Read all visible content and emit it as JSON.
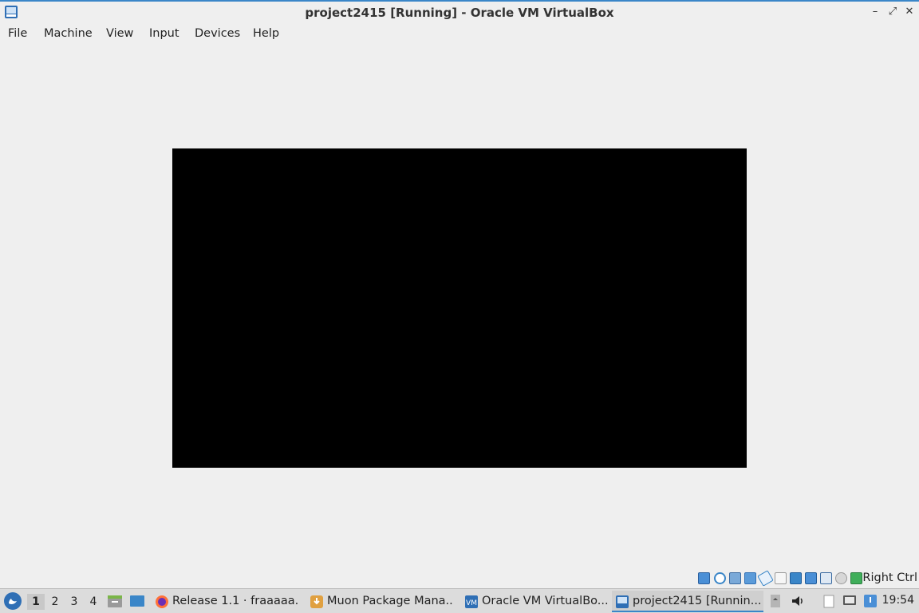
{
  "window": {
    "title": "project2415 [Running] - Oracle VM VirtualBox",
    "minimize_glyph": "–",
    "maximize_glyph": "⤢",
    "close_glyph": "✕"
  },
  "menubar": {
    "items": [
      "File",
      "Machine",
      "View",
      "Input",
      "Devices",
      "Help"
    ]
  },
  "statusbar": {
    "icons": [
      "hard-disk-icon",
      "optical-drive-icon",
      "audio-icon",
      "network-icon",
      "usb-icon",
      "shared-folders-icon",
      "display-icon",
      "video-capture-icon",
      "recording-icon",
      "cpu-icon",
      "mouse-integration-icon",
      "keyboard-icon"
    ],
    "host_key": "Right Ctrl"
  },
  "taskbar": {
    "desktops": [
      "1",
      "2",
      "3",
      "4"
    ],
    "active_desktop": "1",
    "tasks": [
      {
        "label": "Release 1.1 · fraaaaa...",
        "icon": "firefox-icon"
      },
      {
        "label": "Muon Package Mana...",
        "icon": "muon-icon"
      },
      {
        "label": "Oracle VM VirtualBo...",
        "icon": "virtualbox-icon"
      },
      {
        "label": "project2415 [Runnin...",
        "icon": "virtualbox-vm-icon"
      }
    ],
    "clock": "19:54"
  },
  "colors": {
    "accent": "#3a86c8",
    "vm_screen": "#000000",
    "background": "#efefef"
  }
}
